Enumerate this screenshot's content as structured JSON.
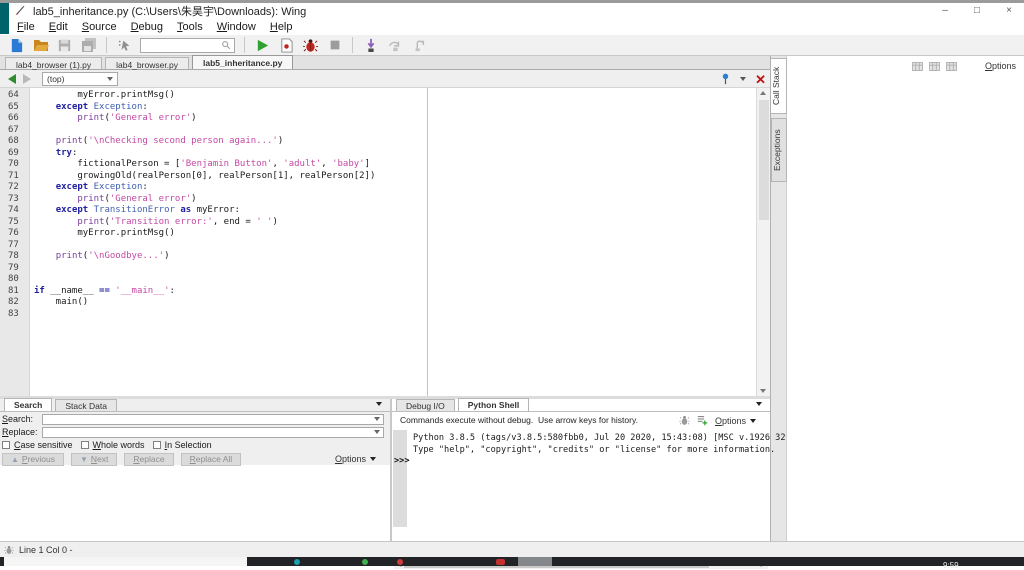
{
  "window": {
    "title": "lab5_inheritance.py (C:\\Users\\朱昊宇\\Downloads): Wing",
    "controls": {
      "minimize": "–",
      "maximize": "□",
      "close": "×"
    }
  },
  "menu": [
    "File",
    "Edit",
    "Source",
    "Debug",
    "Tools",
    "Window",
    "Help"
  ],
  "toolbar": {
    "search_value": ""
  },
  "editor_tabs": [
    {
      "label": "lab4_browser (1).py"
    },
    {
      "label": "lab4_browser.py"
    },
    {
      "label": "lab5_inheritance.py"
    }
  ],
  "nav": {
    "scope": "(top)",
    "close": "✕"
  },
  "editor": {
    "code_lines": [
      {
        "n": 64,
        "t": [
          [
            "p",
            "        myError.printMsg()"
          ]
        ]
      },
      {
        "n": 65,
        "t": [
          [
            "p",
            "    "
          ],
          [
            "k",
            "except"
          ],
          [
            "p",
            " "
          ],
          [
            "c",
            "Exception"
          ],
          [
            "p",
            ":"
          ]
        ]
      },
      {
        "n": 66,
        "t": [
          [
            "p",
            "        "
          ],
          [
            "b",
            "print"
          ],
          [
            "p",
            "("
          ],
          [
            "s",
            "'General error'"
          ],
          [
            "p",
            ")"
          ]
        ]
      },
      {
        "n": 67,
        "t": []
      },
      {
        "n": 68,
        "t": [
          [
            "p",
            "    "
          ],
          [
            "b",
            "print"
          ],
          [
            "p",
            "("
          ],
          [
            "s",
            "'\\nChecking second person again...'"
          ],
          [
            "p",
            ")"
          ]
        ]
      },
      {
        "n": 69,
        "t": [
          [
            "p",
            "    "
          ],
          [
            "k",
            "try"
          ],
          [
            "p",
            ":"
          ]
        ]
      },
      {
        "n": 70,
        "t": [
          [
            "p",
            "        fictionalPerson = ["
          ],
          [
            "s",
            "'Benjamin Button'"
          ],
          [
            "p",
            ", "
          ],
          [
            "s",
            "'adult'"
          ],
          [
            "p",
            ", "
          ],
          [
            "s",
            "'baby'"
          ],
          [
            "p",
            "]"
          ]
        ]
      },
      {
        "n": 71,
        "t": [
          [
            "p",
            "        growingOld(realPerson[0], realPerson[1], realPerson[2])"
          ]
        ]
      },
      {
        "n": 72,
        "t": [
          [
            "p",
            "    "
          ],
          [
            "k",
            "except"
          ],
          [
            "p",
            " "
          ],
          [
            "c",
            "Exception"
          ],
          [
            "p",
            ":"
          ]
        ]
      },
      {
        "n": 73,
        "t": [
          [
            "p",
            "        "
          ],
          [
            "b",
            "print"
          ],
          [
            "p",
            "("
          ],
          [
            "s",
            "'General error'"
          ],
          [
            "p",
            ")"
          ]
        ]
      },
      {
        "n": 74,
        "t": [
          [
            "p",
            "    "
          ],
          [
            "k",
            "except"
          ],
          [
            "p",
            " "
          ],
          [
            "c",
            "TransitionError"
          ],
          [
            "p",
            " "
          ],
          [
            "k",
            "as"
          ],
          [
            "p",
            " myError:"
          ]
        ]
      },
      {
        "n": 75,
        "t": [
          [
            "p",
            "        "
          ],
          [
            "b",
            "print"
          ],
          [
            "p",
            "("
          ],
          [
            "s",
            "'Transition error:'"
          ],
          [
            "p",
            ", end = "
          ],
          [
            "s",
            "' '"
          ],
          [
            "p",
            ")"
          ]
        ]
      },
      {
        "n": 76,
        "t": [
          [
            "p",
            "        myError.printMsg()"
          ]
        ]
      },
      {
        "n": 77,
        "t": []
      },
      {
        "n": 78,
        "t": [
          [
            "p",
            "    "
          ],
          [
            "b",
            "print"
          ],
          [
            "p",
            "("
          ],
          [
            "s",
            "'\\nGoodbye...'"
          ],
          [
            "p",
            ")"
          ]
        ]
      },
      {
        "n": 79,
        "t": []
      },
      {
        "n": 80,
        "t": []
      },
      {
        "n": 81,
        "t": [
          [
            "k",
            "if"
          ],
          [
            "p",
            " __name__ "
          ],
          [
            "k",
            "=="
          ],
          [
            "p",
            " "
          ],
          [
            "s",
            "'__main__'"
          ],
          [
            "p",
            ":"
          ]
        ]
      },
      {
        "n": 82,
        "t": [
          [
            "p",
            "    main()"
          ]
        ]
      },
      {
        "n": 83,
        "t": []
      }
    ],
    "syntax_colors": {
      "keyword": "#2020a0",
      "classname": "#4060b0",
      "builtin": "#7a3e9d",
      "string": "#c348a5"
    }
  },
  "right_panel": {
    "tabs": [
      {
        "label": "Call Stack"
      },
      {
        "label": "Exceptions"
      }
    ],
    "options_label": "Options"
  },
  "search_panel": {
    "tabs": [
      {
        "label": "Search"
      },
      {
        "label": "Stack Data"
      }
    ],
    "search_label": "Search:",
    "replace_label": "Replace:",
    "search_value": "",
    "replace_value": "",
    "checkboxes": [
      "Case sensitive",
      "Whole words",
      "In Selection"
    ],
    "buttons": [
      "Previous",
      "Next",
      "Replace",
      "Replace All"
    ],
    "options_label": "Options"
  },
  "shell_panel": {
    "tabs": [
      {
        "label": "Debug I/O"
      },
      {
        "label": "Python Shell"
      }
    ],
    "hint": "Commands execute without debug.  Use arrow keys for history.",
    "options_label": "Options",
    "output_lines": [
      "Python 3.8.5 (tags/v3.8.5:580fbb0, Jul 20 2020, 15:43:08) [MSC v.1926 32",
      "Type \"help\", \"copyright\", \"credits\" or \"license\" for more information."
    ],
    "prompt": ">>>"
  },
  "status_bar": {
    "text": "Line 1 Col 0 -"
  },
  "taskbar": {
    "clock": "9:59",
    "app_icon_colors": [
      "#1a9fb0",
      "#3faf4f",
      "#d03a3a",
      "#c23030"
    ]
  }
}
